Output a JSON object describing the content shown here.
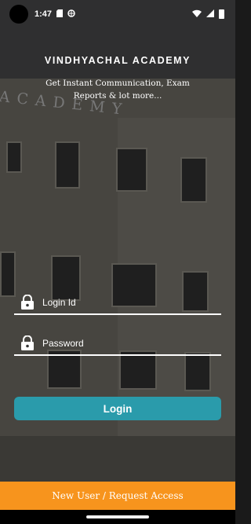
{
  "status": {
    "time": "1:47",
    "icons": [
      "sd-card-icon",
      "vpn-icon",
      "wifi-icon",
      "signal-icon",
      "battery-icon"
    ]
  },
  "brand": {
    "title": "VINDHYACHAL ACADEMY",
    "tagline": "Get Instant Communication, Exam Reports & lot more..."
  },
  "form": {
    "login_id_placeholder": "Login Id",
    "password_placeholder": "Password",
    "login_label": "Login"
  },
  "footer": {
    "request_label": "New User / Request Access"
  },
  "background": {
    "sign_text": "ACADEMY"
  },
  "colors": {
    "accent": "#2a9bab",
    "footer": "#f7941d"
  }
}
